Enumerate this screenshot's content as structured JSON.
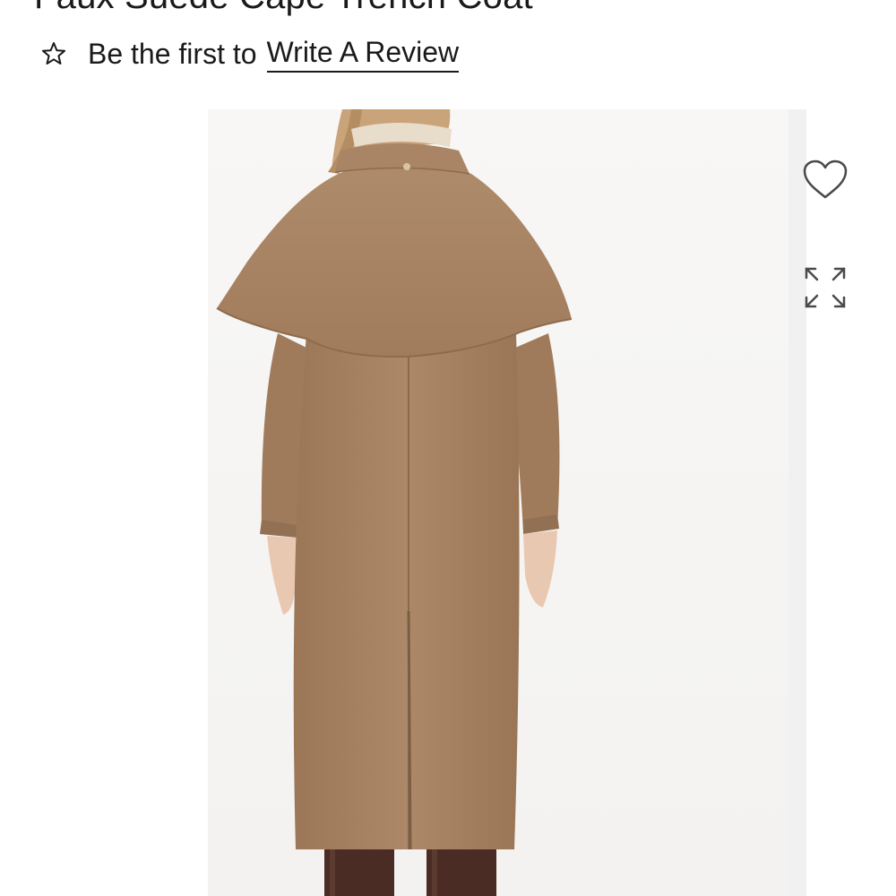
{
  "product": {
    "title": "Faux Suede Cape Trench Coat"
  },
  "reviews": {
    "prompt": "Be the first to",
    "link_label": "Write A Review",
    "star_icon": "star-outline-icon"
  },
  "gallery": {
    "image_alt": "Back view of model wearing camel faux suede cape trench coat",
    "coat_color": "#a88463",
    "boot_color": "#4a2c24",
    "actions": {
      "favorite_icon": "heart-outline-icon",
      "expand_icon": "expand-arrows-icon"
    }
  }
}
